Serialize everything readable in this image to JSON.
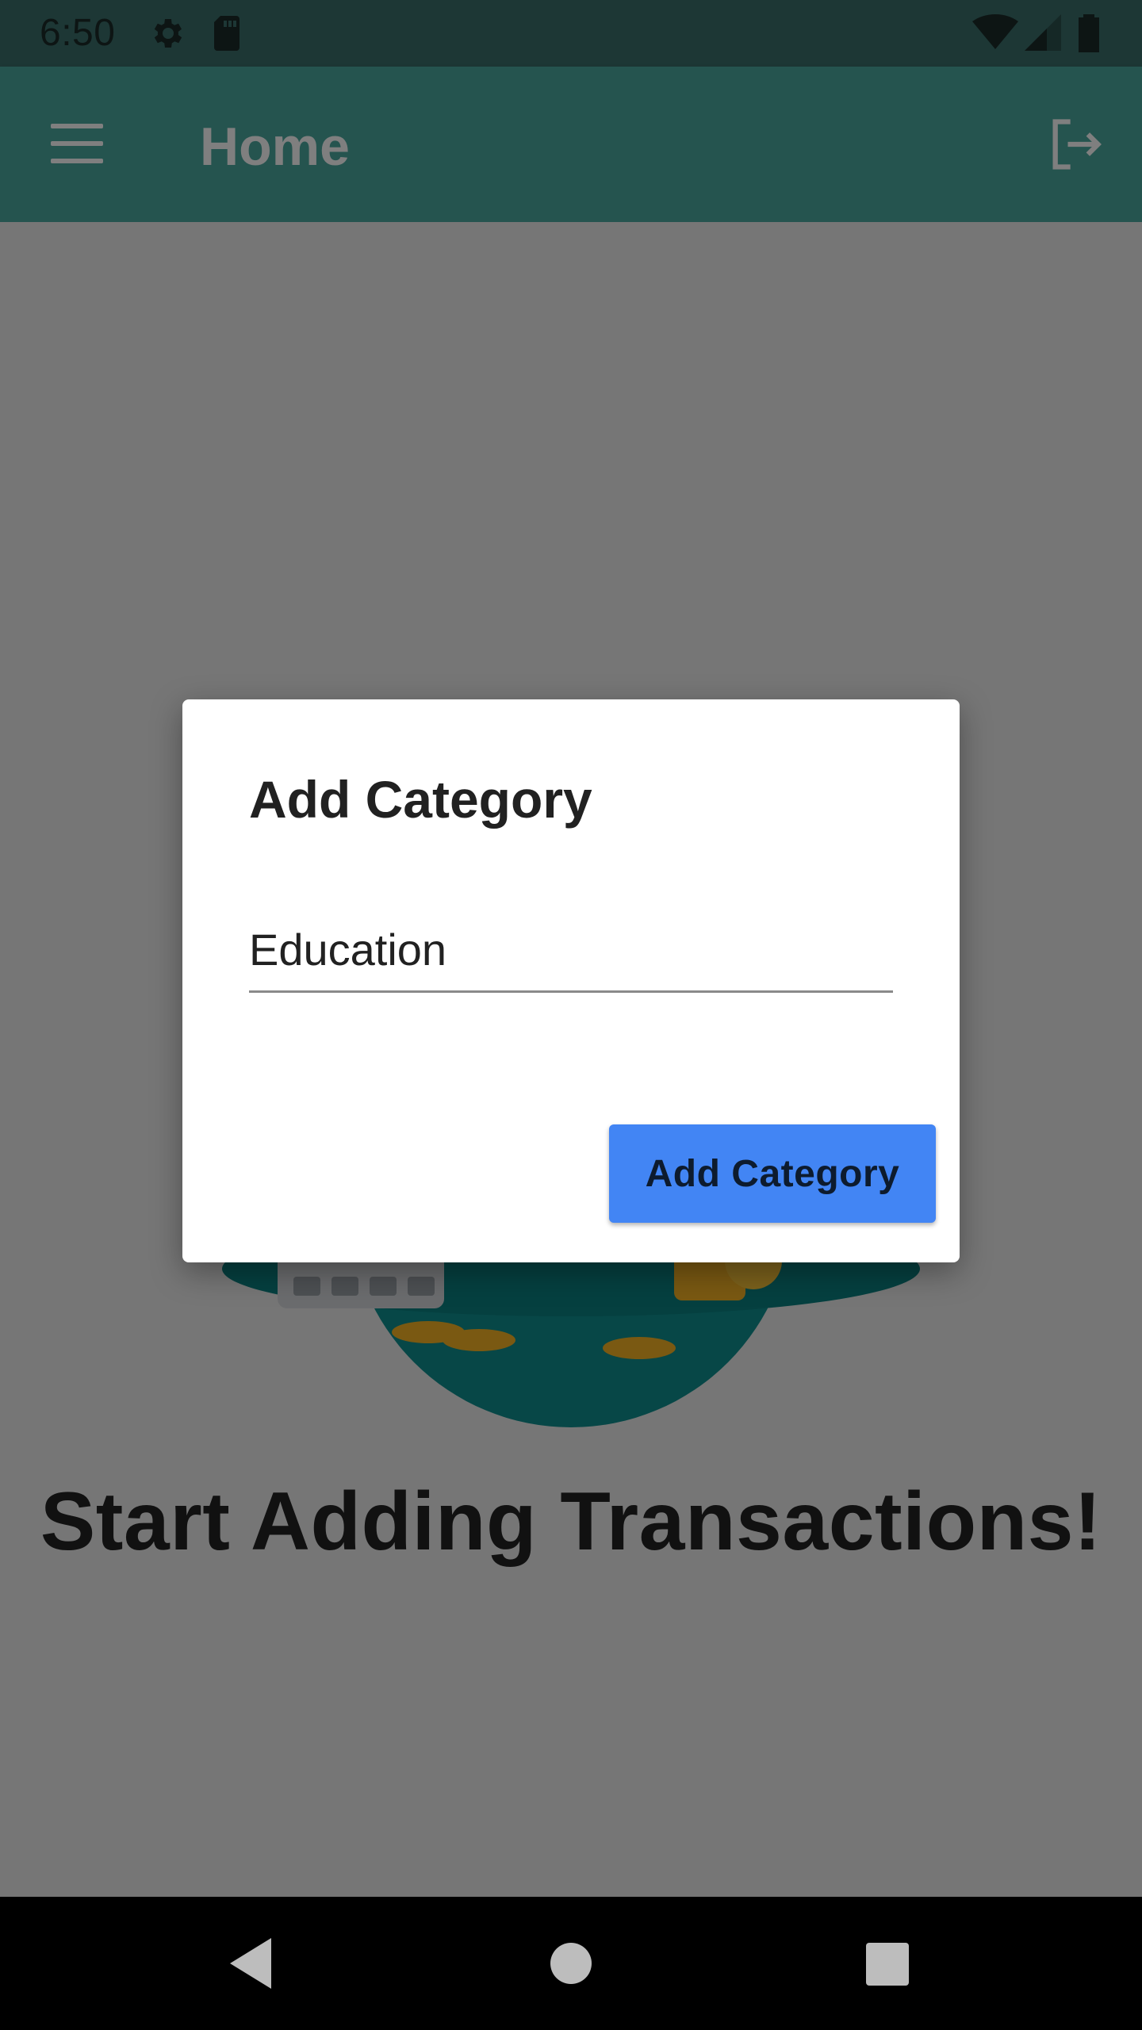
{
  "status_bar": {
    "time": "6:50",
    "icons": [
      "settings-icon",
      "sd-card-icon",
      "wifi-icon",
      "cell-signal-icon",
      "battery-icon"
    ]
  },
  "app_bar": {
    "title": "Home",
    "left_icon": "menu-icon",
    "right_icon": "logout-icon",
    "color": "#4aa89f"
  },
  "main": {
    "empty_message": "Start Adding Transactions!"
  },
  "dialog": {
    "title": "Add Category",
    "input_value": "Education",
    "submit_label": "Add Category",
    "button_color": "#4285f4"
  },
  "nav_bar": {
    "icons": [
      "back-icon",
      "home-icon",
      "recents-icon"
    ]
  }
}
